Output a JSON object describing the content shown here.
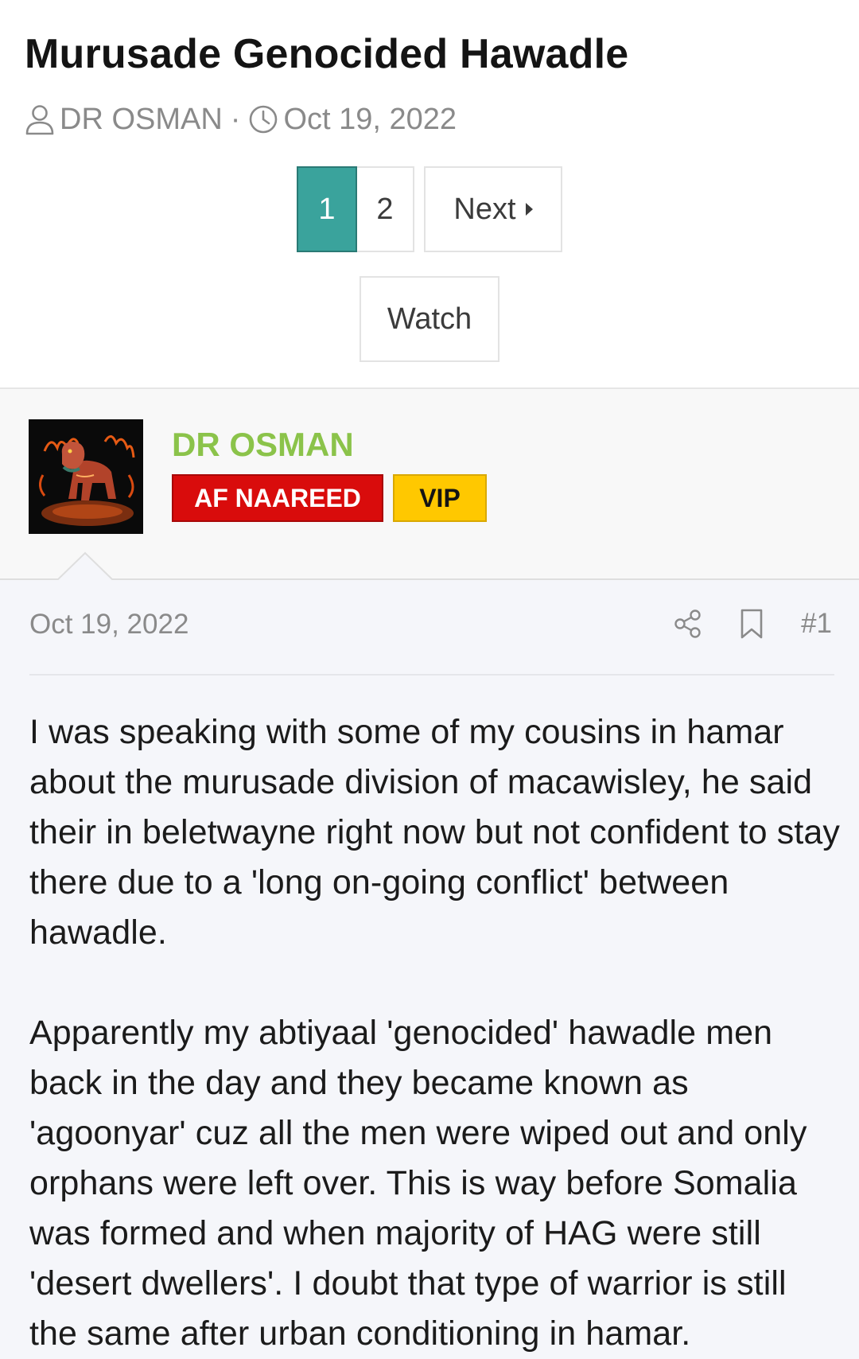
{
  "thread": {
    "title": "Murusade Genocided Hawadle",
    "author": "DR OSMAN",
    "date": "Oct 19, 2022"
  },
  "pagination": {
    "current": "1",
    "page2": "2",
    "next_label": "Next"
  },
  "watch_label": "Watch",
  "user": {
    "name": "DR OSMAN",
    "badge_primary": "AF NAAREED",
    "badge_vip": "VIP"
  },
  "post": {
    "date": "Oct 19, 2022",
    "number": "#1",
    "paragraphs": [
      "I was speaking with some of my cousins in hamar about the murusade division of macawisley, he said their in beletwayne right now but not confident to stay there due to a 'long on-going conflict' between hawadle.",
      "Apparently my abtiyaal 'genocided' hawadle men back in the day and they became known as 'agoonyar' cuz all the men were wiped out and only orphans were left over. This is way before Somalia was formed and when majority of HAG were still 'desert dwellers'. I doubt that type of warrior is still the same after urban conditioning in hamar."
    ]
  },
  "colors": {
    "page_current": "#3aa39c",
    "username": "#8bc34a",
    "badge_red": "#d90c0c",
    "badge_vip": "#ffc800"
  },
  "icons": [
    "user-icon",
    "clock-icon",
    "caret-right-icon",
    "share-icon",
    "bookmark-icon"
  ]
}
